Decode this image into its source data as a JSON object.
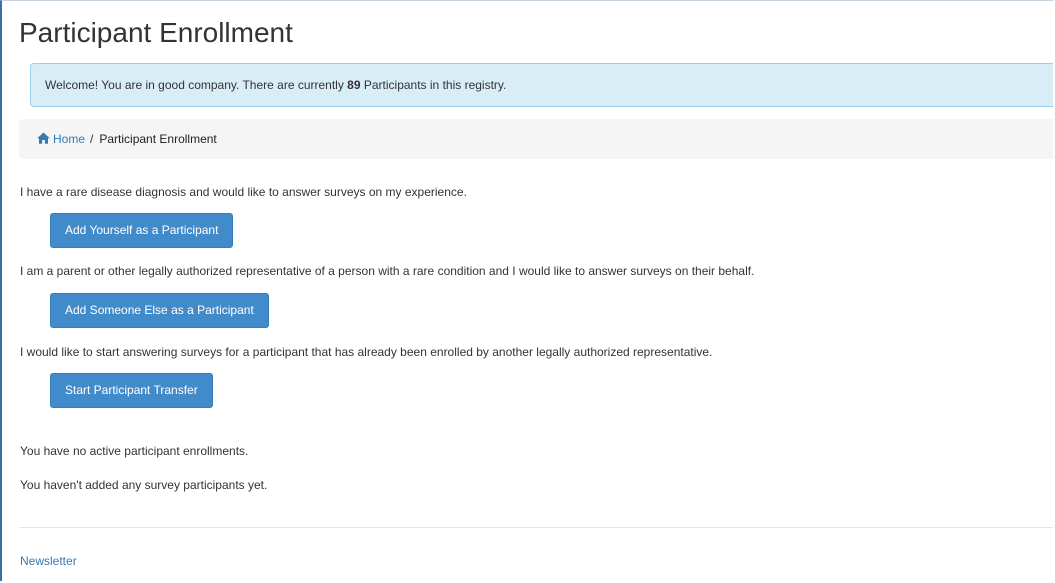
{
  "page": {
    "title": "Participant Enrollment"
  },
  "alert": {
    "text_before": "Welcome! You are in good company. There are currently ",
    "count": "89",
    "text_after": " Participants in this registry."
  },
  "breadcrumb": {
    "home_label": "Home",
    "separator": "/",
    "current": "Participant Enrollment"
  },
  "options": [
    {
      "description": "I have a rare disease diagnosis and would like to answer surveys on my experience.",
      "button_label": "Add Yourself as a Participant"
    },
    {
      "description": "I am a parent or other legally authorized representative of a person with a rare condition and I would like to answer surveys on their behalf.",
      "button_label": "Add Someone Else as a Participant"
    },
    {
      "description": "I would like to start answering surveys for a participant that has already been enrolled by another legally authorized representative.",
      "button_label": "Start Participant Transfer"
    }
  ],
  "status": {
    "enrollments": "You have no active participant enrollments.",
    "survey_participants": "You haven't added any survey participants yet."
  },
  "footer": {
    "newsletter_label": "Newsletter"
  },
  "icons": {
    "home": "home-icon"
  },
  "colors": {
    "primary": "#428bca",
    "link": "#337ab7",
    "alert_bg": "#d9edf7",
    "alert_border": "#9acfea"
  }
}
